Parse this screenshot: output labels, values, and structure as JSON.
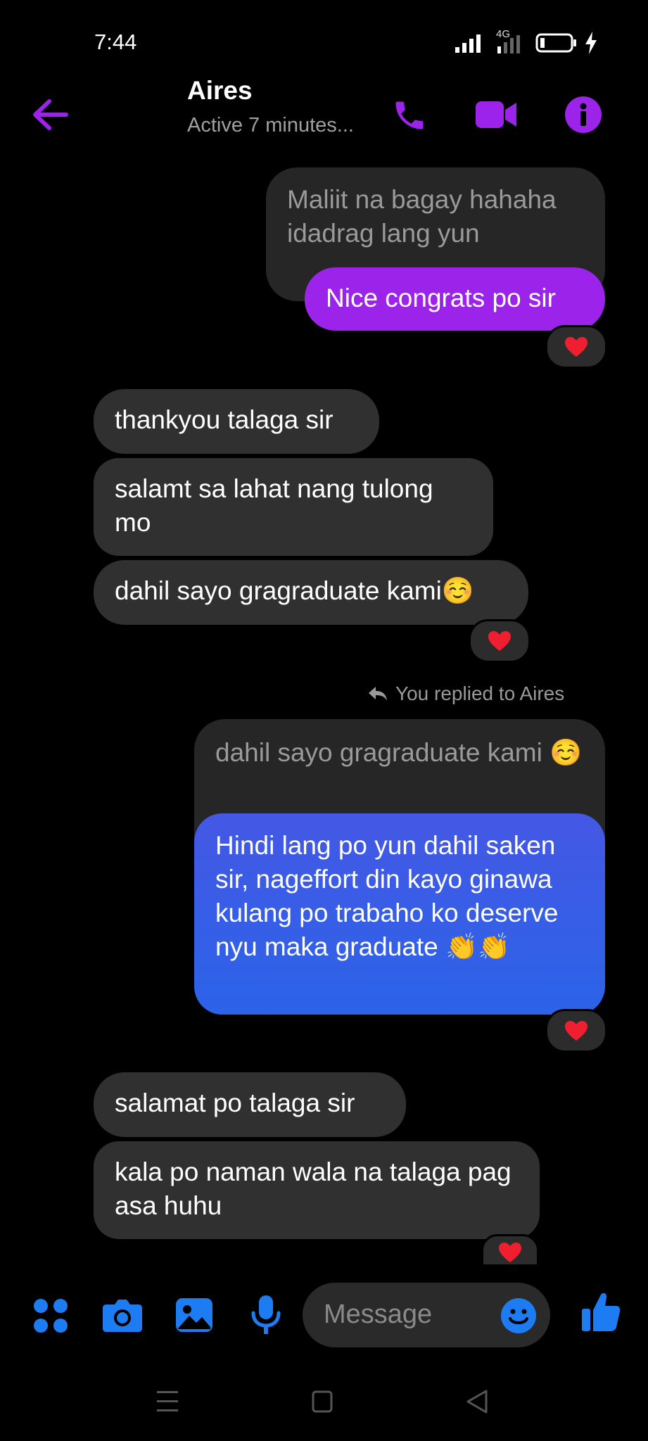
{
  "status_bar": {
    "time": "7:44",
    "network": "4G"
  },
  "header": {
    "name": "Aires",
    "status": "Active 7 minutes..."
  },
  "messages": {
    "quoted_1": "Maliit na bagay hahaha idadrag lang yun",
    "sent_1": "Nice congrats po sir",
    "recv_1": "thankyou talaga sir",
    "recv_2": "salamt sa lahat nang tulong mo",
    "recv_3": "dahil sayo gragraduate kami☺️",
    "reply_note": "You replied to Aires",
    "quoted_2": "dahil sayo gragraduate kami ☺️",
    "sent_2": "Hindi lang po yun dahil saken sir, nageffort din kayo ginawa kulang po trabaho ko deserve nyu maka graduate 👏👏",
    "recv_4": "salamat po talaga sir",
    "recv_5": "kala po naman wala na talaga pag asa huhu"
  },
  "composer": {
    "placeholder": "Message"
  },
  "colors": {
    "accent_purple": "#9b23ea",
    "accent_blue": "#1e7cf2",
    "bubble_grey": "#303030"
  }
}
